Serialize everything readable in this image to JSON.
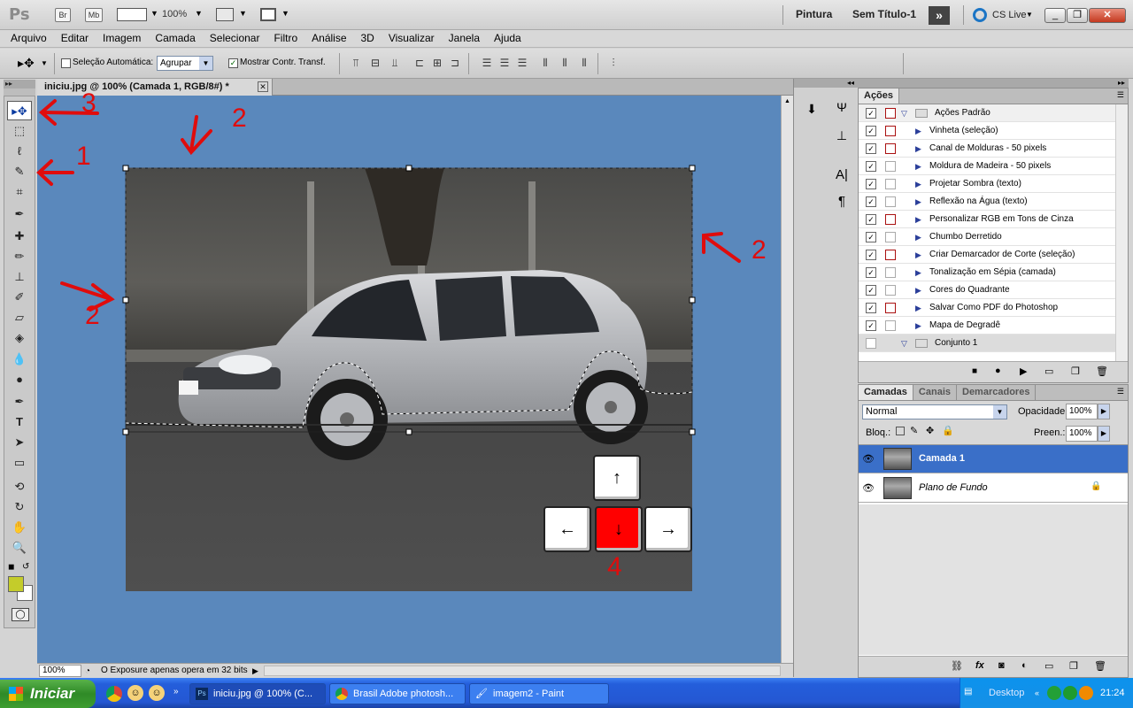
{
  "appbar": {
    "logo": "Ps",
    "bridge_label": "Br",
    "minibridge_label": "Mb",
    "zoom_label": "100%",
    "workspace_label": "Pintura",
    "document_title": "Sem Título-1",
    "cslive_label": "CS Live"
  },
  "menu": [
    "Arquivo",
    "Editar",
    "Imagem",
    "Camada",
    "Selecionar",
    "Filtro",
    "Análise",
    "3D",
    "Visualizar",
    "Janela",
    "Ajuda"
  ],
  "options": {
    "auto_select_label": "Seleção Automática:",
    "auto_select_value": "Agrupar",
    "show_transform_label": "Mostrar Contr. Transf."
  },
  "document": {
    "tab_title": "iniciu.jpg @ 100% (Camada 1, RGB/8#) *",
    "zoom": "100%",
    "status_text": "O Exposure apenas opera em 32 bits"
  },
  "annotations": {
    "n1": "1",
    "n2": "2",
    "n3": "3",
    "n4": "4"
  },
  "actions_panel": {
    "tab": "Ações",
    "set_name": "Ações Padrão",
    "items": [
      {
        "label": "Vinheta (seleção)",
        "dialog": true
      },
      {
        "label": "Canal de Molduras - 50 pixels",
        "dialog": true
      },
      {
        "label": "Moldura de Madeira - 50 pixels",
        "dialog": false
      },
      {
        "label": "Projetar Sombra (texto)",
        "dialog": false
      },
      {
        "label": "Reflexão na Água (texto)",
        "dialog": false
      },
      {
        "label": "Personalizar RGB em Tons de Cinza",
        "dialog": true
      },
      {
        "label": "Chumbo Derretido",
        "dialog": false
      },
      {
        "label": "Criar Demarcador de Corte (seleção)",
        "dialog": true
      },
      {
        "label": "Tonalização em Sépia (camada)",
        "dialog": false
      },
      {
        "label": "Cores do Quadrante",
        "dialog": false
      },
      {
        "label": "Salvar Como PDF do Photoshop",
        "dialog": true
      },
      {
        "label": "Mapa de Degradê",
        "dialog": false
      }
    ],
    "set2_name": "Conjunto 1"
  },
  "layers_panel": {
    "tabs": [
      "Camadas",
      "Canais",
      "Demarcadores"
    ],
    "blend_mode": "Normal",
    "opacity_label": "Opacidade:",
    "opacity_value": "100%",
    "lock_label": "Bloq.:",
    "fill_label": "Preen.:",
    "fill_value": "100%",
    "layers": [
      {
        "name": "Camada 1",
        "selected": true
      },
      {
        "name": "Plano de Fundo",
        "selected": false
      }
    ]
  },
  "taskbar": {
    "start_label": "Iniciar",
    "buttons": [
      {
        "label": "iniciu.jpg @ 100% (C...",
        "active": true
      },
      {
        "label": "Brasil Adobe photosh...",
        "active": false
      },
      {
        "label": "imagem2 - Paint",
        "active": false
      }
    ],
    "desktop_label": "Desktop",
    "clock": "21:24"
  },
  "colors": {
    "canvas_bg": "#5a88bc",
    "selected_layer": "#3a6fc8",
    "annotation": "#e00c0c",
    "foreground_swatch": "#c4cc2a"
  }
}
